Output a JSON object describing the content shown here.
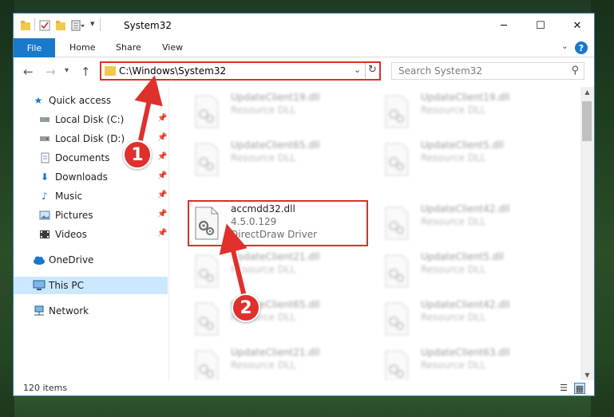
{
  "window": {
    "title": "System32",
    "controls": {
      "minimize": "─",
      "maximize": "☐",
      "close": "✕"
    }
  },
  "ribbon": {
    "tabs": [
      "File",
      "Home",
      "Share",
      "View"
    ],
    "help": "?"
  },
  "address": {
    "path": "C:\\Windows\\System32",
    "search_placeholder": "Search System32"
  },
  "sidebar": {
    "items": [
      {
        "label": "Quick access",
        "icon": "star-icon",
        "pinned": false
      },
      {
        "label": "Local Disk (C:)",
        "icon": "drive-icon",
        "pinned": true
      },
      {
        "label": "Local Disk (D:)",
        "icon": "drive-icon",
        "pinned": true
      },
      {
        "label": "Documents",
        "icon": "documents-icon",
        "pinned": true
      },
      {
        "label": "Downloads",
        "icon": "download-icon",
        "pinned": true
      },
      {
        "label": "Music",
        "icon": "music-icon",
        "pinned": true
      },
      {
        "label": "Pictures",
        "icon": "pictures-icon",
        "pinned": true
      },
      {
        "label": "Videos",
        "icon": "videos-icon",
        "pinned": true
      },
      {
        "label": "OneDrive",
        "icon": "cloud-icon",
        "pinned": false
      },
      {
        "label": "This PC",
        "icon": "computer-icon",
        "pinned": false,
        "selected": true
      },
      {
        "label": "Network",
        "icon": "network-icon",
        "pinned": false
      }
    ]
  },
  "files": [
    {
      "name": "UpdateClient19.dll",
      "sub": "Resource DLL",
      "blurred": true
    },
    {
      "name": "UpdateClient19.dll",
      "sub": "Resource DLL",
      "blurred": true
    },
    {
      "name": "UpdateClient65.dll",
      "sub": "Resource DLL",
      "blurred": true
    },
    {
      "name": "UpdateClient5.dll",
      "sub": "Resource DLL",
      "blurred": true
    },
    {
      "name": "accmdd32.dll",
      "version": "4.5.0.129",
      "sub": "DirectDraw Driver",
      "blurred": false,
      "highlighted": true
    },
    {
      "name": "UpdateClient42.dll",
      "sub": "Resource DLL",
      "blurred": true
    },
    {
      "name": "UpdateClient21.dll",
      "sub": "Resource DLL",
      "blurred": true
    },
    {
      "name": "UpdateClient5.dll",
      "sub": "Resource DLL",
      "blurred": true
    },
    {
      "name": "UpdateClient65.dll",
      "sub": "Resource DLL",
      "blurred": true
    },
    {
      "name": "UpdateClient42.dll",
      "sub": "Resource DLL",
      "blurred": true
    },
    {
      "name": "UpdateClient21.dll",
      "sub": "Resource DLL",
      "blurred": true
    },
    {
      "name": "UpdateClient63.dll",
      "sub": "Resource DLL",
      "blurred": true
    }
  ],
  "status": {
    "count": "120 items"
  },
  "annotations": {
    "step1": "1",
    "step2": "2"
  },
  "colors": {
    "accent": "#1979ca",
    "highlight": "#d9302c",
    "selected": "#cce8ff"
  }
}
